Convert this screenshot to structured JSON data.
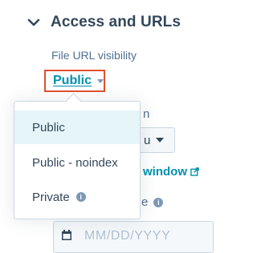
{
  "section": {
    "title": "Access and URLs",
    "icon": "chevron-down-icon"
  },
  "file_url_visibility": {
    "label": "File URL visibility",
    "selected": "Public",
    "options": [
      {
        "label": "Public",
        "selected": true
      },
      {
        "label": "Public - noindex",
        "selected": false
      },
      {
        "label": "Private",
        "selected": false,
        "icon": "info-icon"
      }
    ]
  },
  "background": {
    "label_fragment": "n",
    "select_value_fragment": "u",
    "link_text": "window",
    "link_icon": "external-link-icon",
    "label2_fragment": "e",
    "date_placeholder": "MM/DD/YYYY",
    "date_icon": "calendar-icon"
  },
  "colors": {
    "text": "#33475b",
    "link": "#0091ae",
    "highlight_border": "#e0512e",
    "selected_bg": "#e5f5f8"
  }
}
